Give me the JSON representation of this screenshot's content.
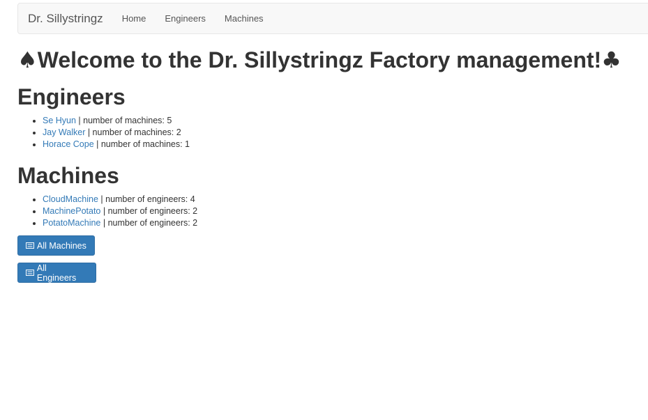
{
  "navbar": {
    "brand": "Dr. Sillystringz",
    "links": [
      "Home",
      "Engineers",
      "Machines"
    ]
  },
  "page": {
    "welcome": "Welcome to the Dr. Sillystringz Factory management!",
    "welcome_prefix_glyph": "♠",
    "welcome_suffix_glyph": "♣"
  },
  "engineers": {
    "heading": "Engineers",
    "items": [
      {
        "name": "Se Hyun",
        "detail": " | number of machines: 5"
      },
      {
        "name": "Jay Walker",
        "detail": " | number of machines: 2"
      },
      {
        "name": "Horace Cope",
        "detail": " | number of machines: 1"
      }
    ]
  },
  "machines": {
    "heading": "Machines",
    "items": [
      {
        "name": "CloudMachine",
        "detail": " | number of engineers: 4"
      },
      {
        "name": "MachinePotato",
        "detail": " | number of engineers: 2"
      },
      {
        "name": "PotatoMachine",
        "detail": " | number of engineers: 2"
      }
    ]
  },
  "buttons": {
    "all_machines": "All Machines",
    "all_engineers": "All Engineers",
    "icon": "list-alt-icon"
  },
  "colors": {
    "link": "#337ab7",
    "button_bg": "#337ab7",
    "navbar_bg": "#f8f8f8",
    "text": "#333333"
  }
}
